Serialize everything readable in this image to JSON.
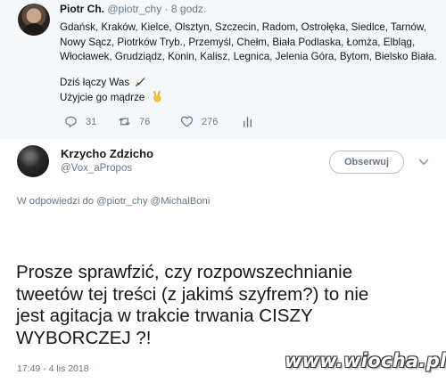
{
  "quoted_tweet": {
    "name": "Piotr Ch.",
    "handle_time": "@piotr_chy · 8 godz.",
    "lines": [
      "Gdańsk, Kraków, Kielce, Olsztyn, Szczecin, Radom, Ostrołęka, Siedlce, Tarnów,",
      "Nowy Sącz, Piotrków Tryb., Przemyśl, Chełm, Biała Podlaska, Łomża, Elbląg,",
      "Włocławek, Grudziądz, Konin, Kalisz, Legnica, Jelenia Góra, Bytom, Bielsko Biała."
    ],
    "line_today": "Dziś łączy Was",
    "line_use": "Użyjcie go mądrze",
    "today_icon": "dagger-icon",
    "use_icon": "victory-hand-icon",
    "reply_count": "31",
    "retweet_count": "76",
    "like_count": "276"
  },
  "tweet": {
    "name": "Krzycho Zdzicho",
    "handle": "@Vox_aPropos",
    "follow_label": "Obserwuj",
    "reply_prefix": "W odpowiedzi do",
    "reply_handles": "@piotr_chy @MichalBoni",
    "text_lines": [
      "Prosze sprawfzić, czy rozpowszechnianie",
      "tweetów tej treści (z jakimś szyfrem?) to nie",
      "jest agitacja w trakcie trwania CISZY",
      "WYBORCZEJ ?!"
    ],
    "timestamp": "17:49 - 4 lis 2018"
  },
  "watermark": "www.wiocha.pl",
  "colors": {
    "text": "#14171a",
    "secondary": "#657786",
    "quoted_background": "#f5f8fa",
    "button_border": "#b8c4cc"
  }
}
